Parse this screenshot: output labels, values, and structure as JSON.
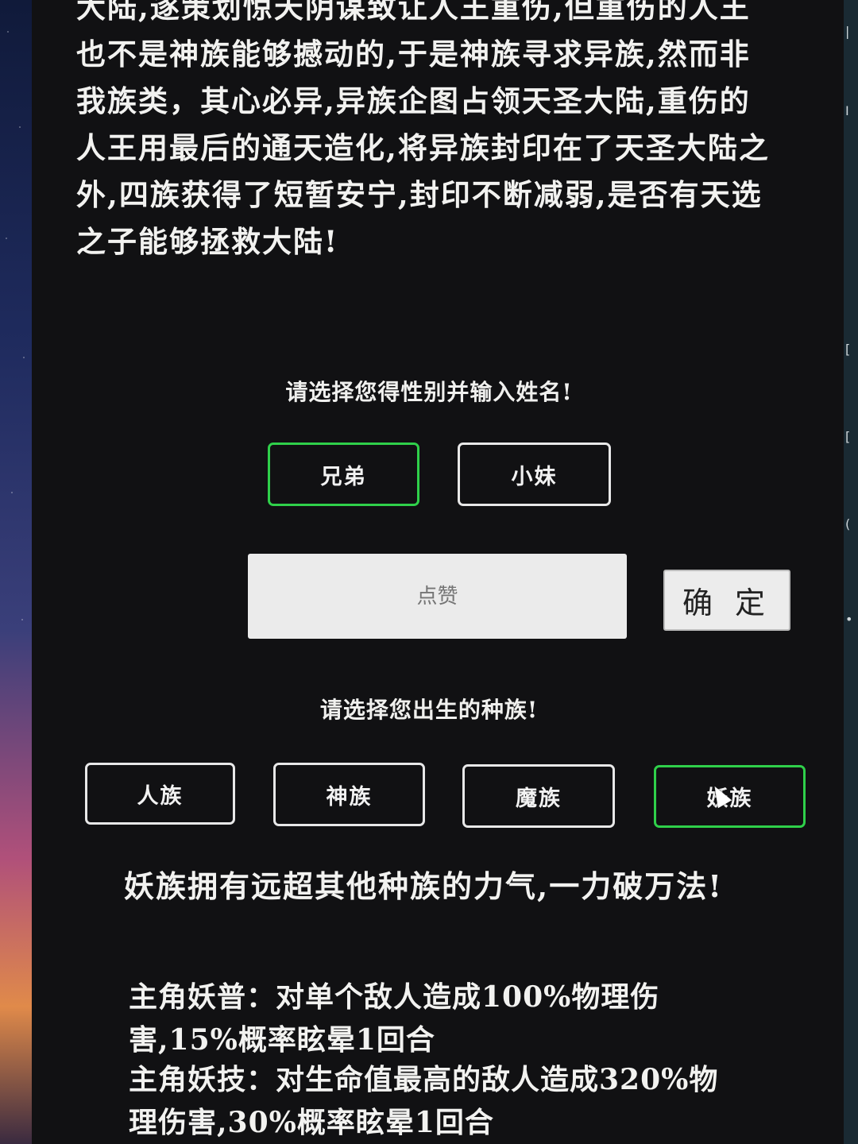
{
  "story": {
    "text": "大陆,遂策划惊天阴谋致让人王重伤,但重伤的人王也不是神族能够撼动的,于是神族寻求异族,然而非我族类，其心必异,异族企图占领天圣大陆,重伤的人王用最后的通天造化,将异族封印在了天圣大陆之外,四族获得了短暂安宁,封印不断减弱,是否有天选之子能够拯救大陆!"
  },
  "gender": {
    "prompt": "请选择您得性别并输入姓名!",
    "options": [
      {
        "label": "兄弟",
        "selected": true
      },
      {
        "label": "小妹",
        "selected": false
      }
    ]
  },
  "name": {
    "placeholder": "点赞",
    "value": ""
  },
  "confirm_label": "确 定",
  "race": {
    "prompt": "请选择您出生的种族!",
    "options": [
      {
        "label": "人族",
        "selected": false
      },
      {
        "label": "神族",
        "selected": false
      },
      {
        "label": "魔族",
        "selected": false
      },
      {
        "label": "妖族",
        "selected": true
      }
    ]
  },
  "race_info": {
    "description": "妖族拥有远超其他种族的力气,一力破万法!",
    "skills": [
      "主角妖普：对单个敌人造成100%物理伤害,15%概率眩晕1回合",
      "主角妖技：对生命值最高的敌人造成320%物理伤害,30%概率眩晕1回合"
    ]
  },
  "colors": {
    "background": "#111113",
    "selected_border": "#2fd04a",
    "default_border": "#e8e8e8",
    "text": "#f2f2f0"
  },
  "icons": {
    "cursor": "mouse-pointer-icon"
  }
}
